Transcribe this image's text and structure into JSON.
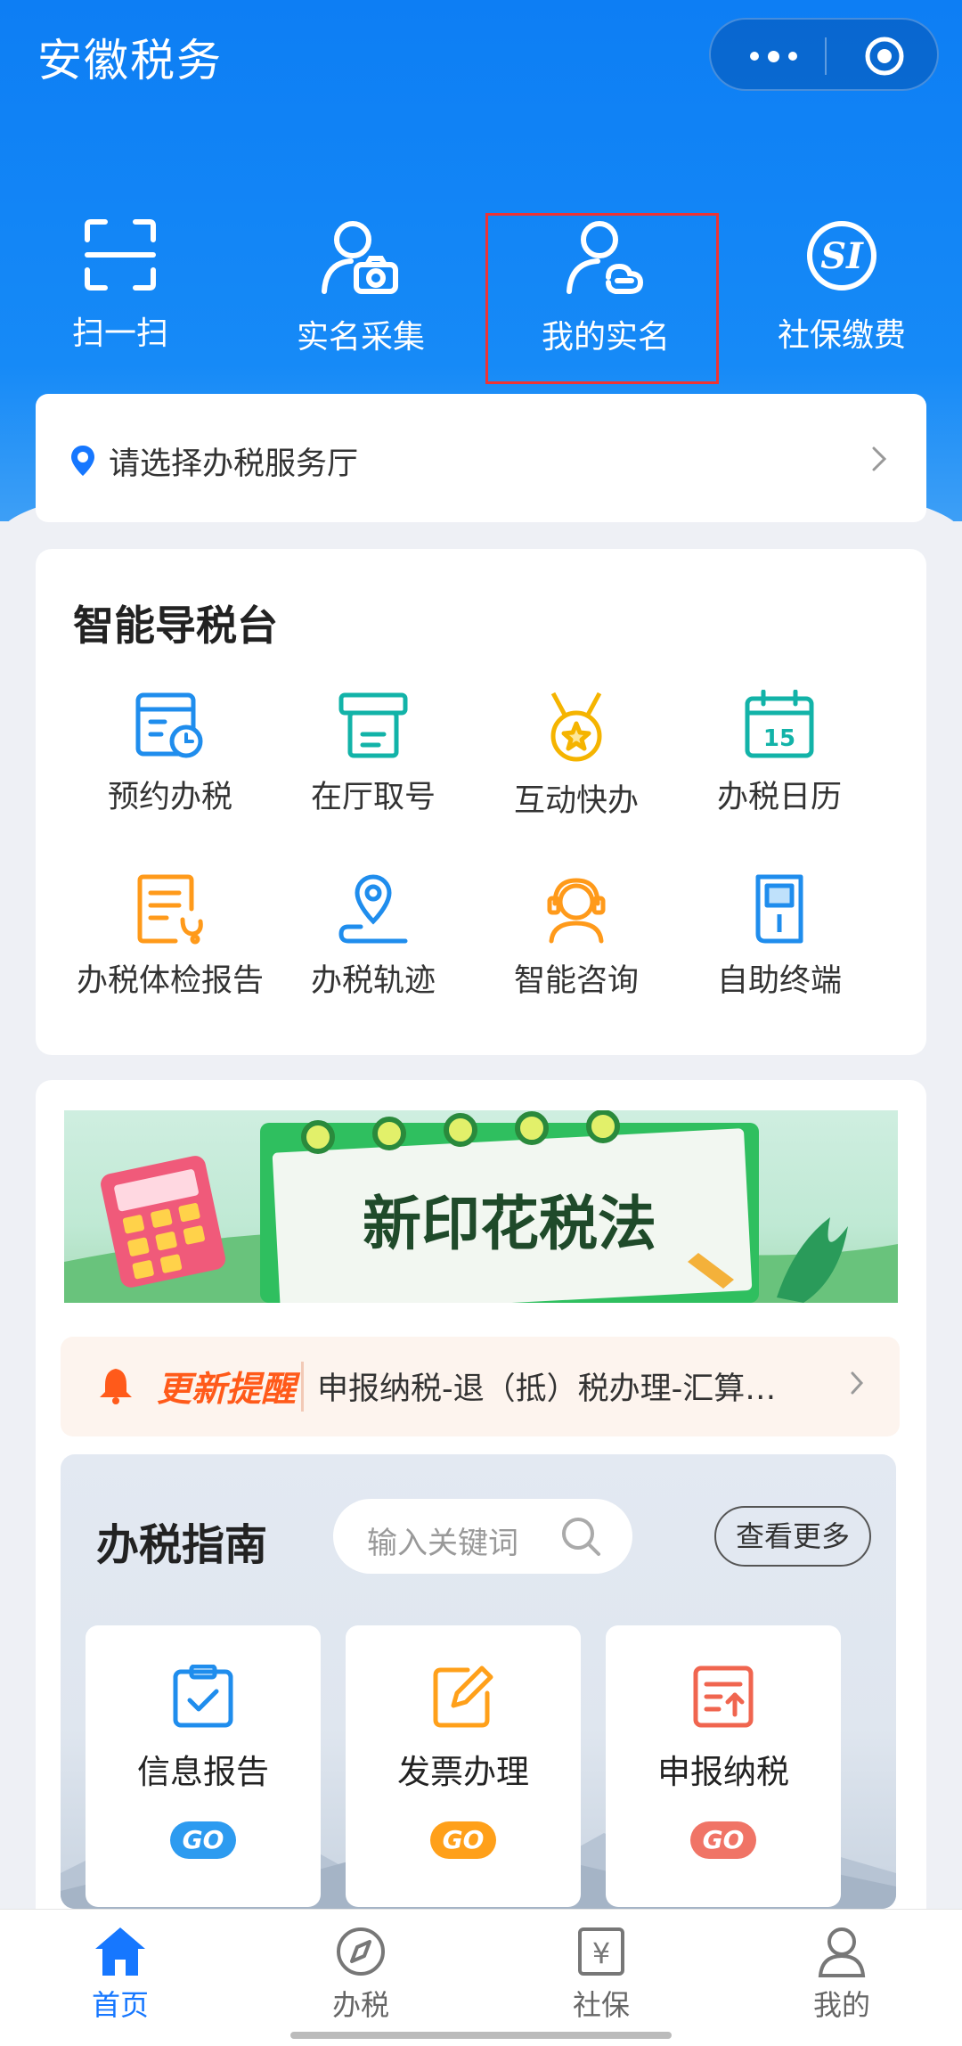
{
  "app": {
    "title": "安徽税务"
  },
  "colors": {
    "primary": "#1677ff",
    "hero": "#0d7ef4",
    "orange": "#ffa01a",
    "teal": "#12b3a8",
    "red": "#f0654f"
  },
  "quick_actions": [
    {
      "label": "扫一扫",
      "icon": "scan-icon"
    },
    {
      "label": "实名采集",
      "icon": "user-camera-icon"
    },
    {
      "label": "我的实名",
      "icon": "user-link-icon"
    },
    {
      "label": "社保缴费",
      "icon": "social-security-icon"
    }
  ],
  "service_hall": {
    "placeholder": "请选择办税服务厅"
  },
  "smart_desk": {
    "title": "智能导税台",
    "items": [
      {
        "label": "预约办税",
        "icon": "appointment-icon"
      },
      {
        "label": "在厅取号",
        "icon": "ticket-machine-icon"
      },
      {
        "label": "互动快办",
        "icon": "medal-icon"
      },
      {
        "label": "办税日历",
        "icon": "calendar-icon",
        "badge": "15"
      },
      {
        "label": "办税体检报告",
        "icon": "report-icon"
      },
      {
        "label": "办税轨迹",
        "icon": "location-track-icon"
      },
      {
        "label": "智能咨询",
        "icon": "customer-service-icon"
      },
      {
        "label": "自助终端",
        "icon": "terminal-icon"
      }
    ]
  },
  "banner": {
    "text": "新印花税法"
  },
  "notice": {
    "tag": "更新提醒",
    "text": "申报纳税-退（抵）税办理-汇算…"
  },
  "guide": {
    "title": "办税指南",
    "search_placeholder": "输入关键词",
    "more": "查看更多",
    "cards": [
      {
        "label": "信息报告",
        "go": "GO",
        "color": "#2d9bf0"
      },
      {
        "label": "发票办理",
        "go": "GO",
        "color": "#ffa01a"
      },
      {
        "label": "申报纳税",
        "go": "GO",
        "color": "#f07466"
      }
    ]
  },
  "tabs": [
    {
      "label": "首页",
      "active": true
    },
    {
      "label": "办税",
      "active": false
    },
    {
      "label": "社保",
      "active": false
    },
    {
      "label": "我的",
      "active": false
    }
  ]
}
